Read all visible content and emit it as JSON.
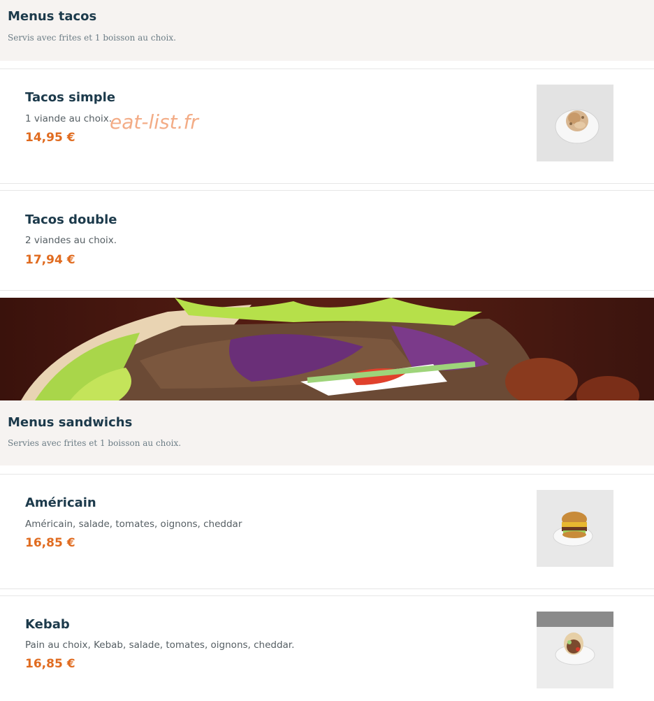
{
  "sections": [
    {
      "title": "Menus tacos",
      "subtitle": "Servis avec frites et 1 boisson au choix.",
      "items": [
        {
          "name": "Tacos simple",
          "description": "1 viande au choix.",
          "price": "14,95 €",
          "photo": "tacos-plate-photo"
        },
        {
          "name": "Tacos double",
          "description": "2 viandes au choix.",
          "price": "17,94 €"
        }
      ]
    },
    {
      "title": "Menus sandwichs",
      "subtitle": "Servies avec frites et 1 boisson au choix.",
      "items": [
        {
          "name": "Américain",
          "description": "Américain, salade, tomates, oignons, cheddar",
          "price": "16,85 €",
          "photo": "burger-plate-photo"
        },
        {
          "name": "Kebab",
          "description": "Pain au choix, Kebab, salade, tomates, oignons, cheddar.",
          "price": "16,85 €",
          "photo": "kebab-plate-photo"
        }
      ]
    }
  ],
  "watermark": "eat-list.fr",
  "banner": {
    "image": "kebab-banner-photo"
  },
  "colors": {
    "price": "#e06b1f",
    "title": "#1c3a4b",
    "section_bg": "#f6f3f1",
    "watermark": "#f2a47a"
  }
}
